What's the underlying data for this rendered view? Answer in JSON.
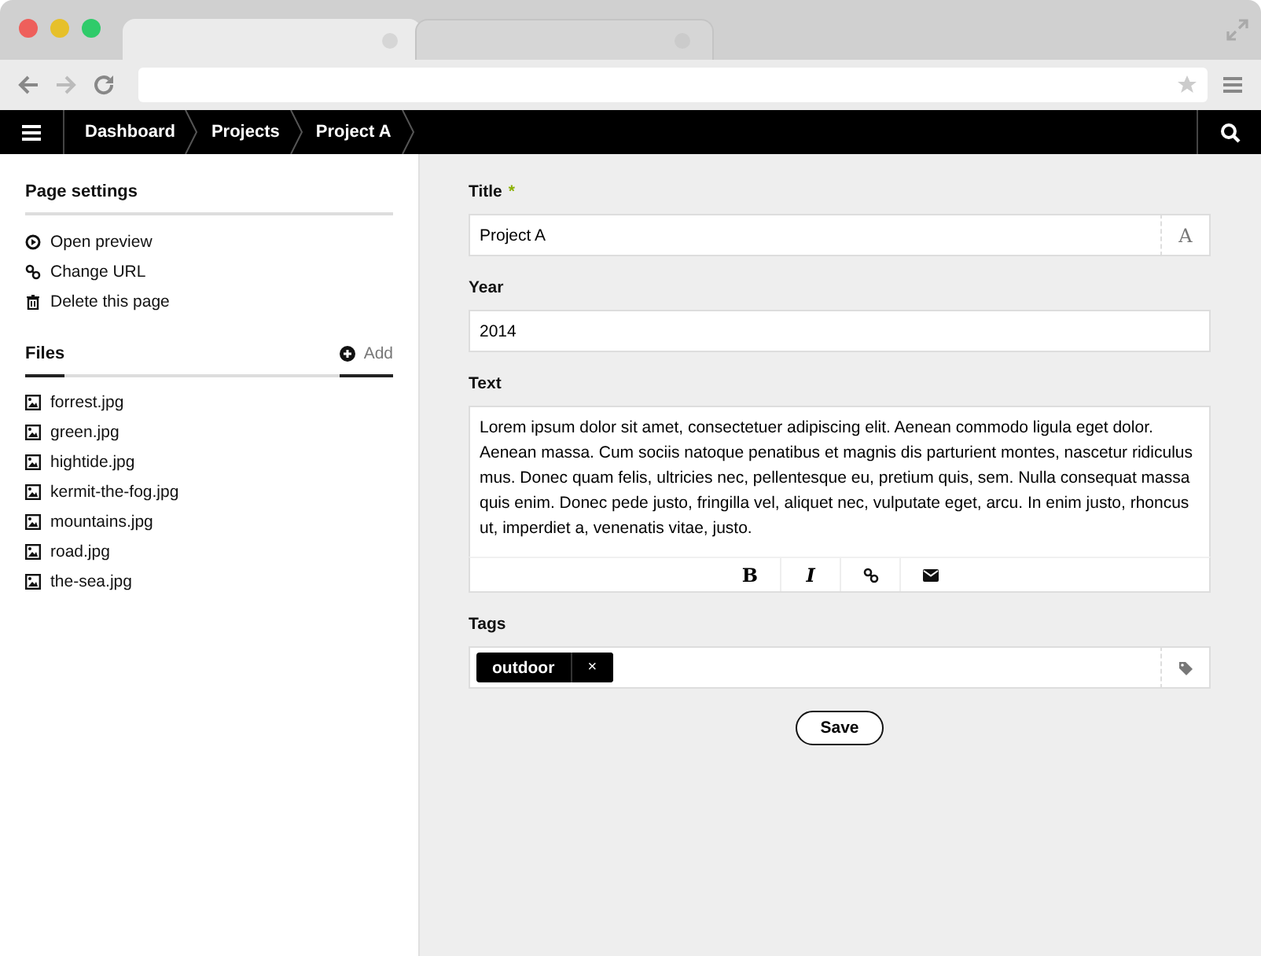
{
  "browser": {
    "tabs": [
      {
        "selected": true
      },
      {
        "selected": false
      }
    ]
  },
  "nav": {
    "breadcrumbs": [
      "Dashboard",
      "Projects",
      "Project A"
    ]
  },
  "sidebar": {
    "settings_title": "Page settings",
    "actions": [
      {
        "kind": "preview",
        "label": "Open preview"
      },
      {
        "kind": "link",
        "label": "Change URL"
      },
      {
        "kind": "trash",
        "label": "Delete this page"
      }
    ],
    "files_title": "Files",
    "add_label": "Add",
    "files": [
      "forrest.jpg",
      "green.jpg",
      "hightide.jpg",
      "kermit-the-fog.jpg",
      "mountains.jpg",
      "road.jpg",
      "the-sea.jpg"
    ]
  },
  "form": {
    "fields": [
      {
        "kind": "text",
        "label": "Title",
        "required_mark": "*",
        "value": "Project A",
        "addon": "A"
      },
      {
        "kind": "text",
        "label": "Year",
        "value": "2014"
      },
      {
        "kind": "textarea",
        "label": "Text",
        "value": "Lorem ipsum dolor sit amet, consectetuer adipiscing elit. Aenean commodo ligula eget dolor. Aenean massa. Cum sociis natoque penatibus et magnis dis parturient montes, nascetur ridiculus mus. Donec quam felis, ultricies nec, pellentesque eu, pretium quis, sem. Nulla consequat massa quis enim. Donec pede justo, fringilla vel, aliquet nec, vulputate eget, arcu. In enim justo, rhoncus ut, imperdiet a, venenatis vitae, justo.",
        "toolbar": [
          {
            "kind": "bold",
            "label": "B"
          },
          {
            "kind": "italic",
            "label": "I"
          },
          {
            "kind": "link"
          },
          {
            "kind": "mail"
          }
        ]
      },
      {
        "kind": "tags",
        "label": "Tags",
        "tags": [
          {
            "label": "outdoor",
            "remove": "×"
          }
        ]
      }
    ],
    "save": "Save"
  }
}
